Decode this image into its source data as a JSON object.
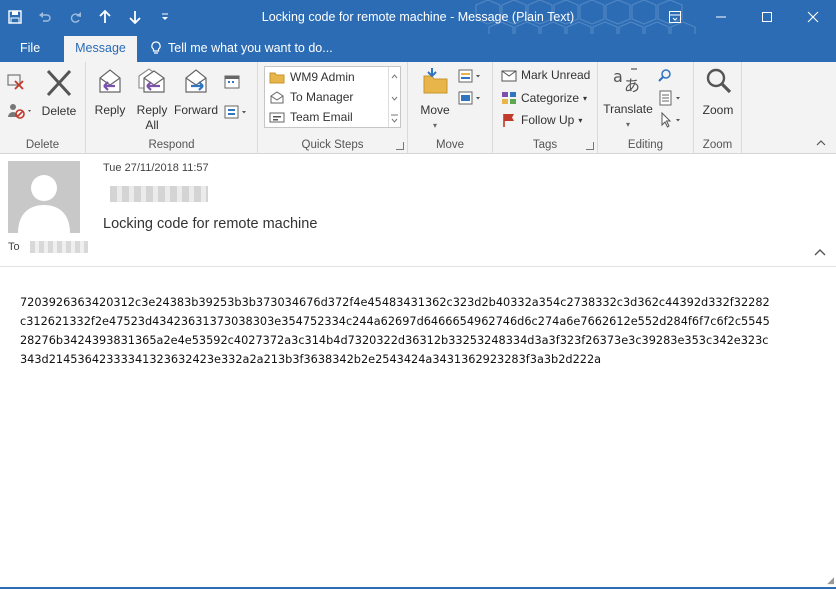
{
  "window": {
    "title": "Locking code for remote machine - Message (Plain Text)",
    "accent": "#2b6cb5"
  },
  "qat": {
    "icons": [
      "save-icon",
      "undo-icon",
      "redo-icon",
      "up-arrow-icon",
      "down-arrow-icon",
      "customize-icon"
    ]
  },
  "tabs": {
    "file": "File",
    "message": "Message",
    "tell_me": "Tell me what you want to do..."
  },
  "ribbon": {
    "delete_group": {
      "label": "Delete",
      "delete_button": "Delete"
    },
    "respond_group": {
      "label": "Respond",
      "reply": "Reply",
      "reply_all_line1": "Reply",
      "reply_all_line2": "All",
      "forward": "Forward"
    },
    "quick_steps": {
      "label": "Quick Steps",
      "items": [
        "WM9 Admin",
        "To Manager",
        "Team Email"
      ]
    },
    "move_group": {
      "label": "Move",
      "move_button": "Move"
    },
    "tags_group": {
      "label": "Tags",
      "mark_unread": "Mark Unread",
      "categorize": "Categorize",
      "follow_up": "Follow Up"
    },
    "editing_group": {
      "label": "Editing",
      "translate": "Translate"
    },
    "zoom_group": {
      "label": "Zoom",
      "zoom_button": "Zoom"
    }
  },
  "message": {
    "date": "Tue 27/11/2018 11:57",
    "subject": "Locking code for remote machine",
    "to_label": "To",
    "body_lines": [
      "7203926363420312c3e24383b39253b3b373034676d372f4e45483431362c323d2b40332a354c2738332c3d362c44392d332f32282",
      "c312621332f2e47523d43423631373038303e354752334c244a62697d6466654962746d6c274a6e7662612e552d284f6f7c6f2c5545",
      "28276b3424393831365a2e4e53592c4027372a3c314b4d7320322d36312b33253248334d3a3f323f26373e3c39283e353c342e323c",
      "343d21453642333341323632423e332a2a213b3f3638342b2e2543424a3431362923283f3a3b2d222a"
    ]
  }
}
